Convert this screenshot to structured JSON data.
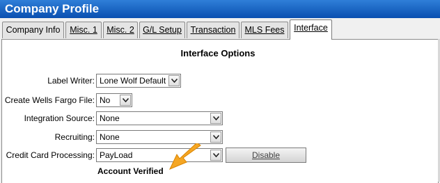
{
  "window": {
    "title": "Company Profile"
  },
  "tabs": [
    {
      "label": "Company Info",
      "active": false
    },
    {
      "label": "Misc. 1",
      "active": false
    },
    {
      "label": "Misc. 2",
      "active": false
    },
    {
      "label": "G/L Setup",
      "active": false
    },
    {
      "label": "Transaction",
      "active": false
    },
    {
      "label": "MLS Fees",
      "active": false
    },
    {
      "label": "Interface",
      "active": true
    }
  ],
  "section": {
    "title": "Interface Options"
  },
  "fields": {
    "label_writer": {
      "label": "Label Writer:",
      "value": "Lone Wolf Default"
    },
    "wells_fargo": {
      "label": "Create Wells Fargo File:",
      "value": "No"
    },
    "integration_source": {
      "label": "Integration Source:",
      "value": "None"
    },
    "recruiting": {
      "label": "Recruiting:",
      "value": "None"
    },
    "credit_card": {
      "label": "Credit Card Processing:",
      "value": "PayLoad"
    }
  },
  "buttons": {
    "disable": "Disable"
  },
  "status": {
    "account": "Account Verified"
  },
  "icons": {
    "dropdown": "chevron-down-icon",
    "callout": "arrow-icon"
  },
  "colors": {
    "titlebar": "#0a4fb0",
    "arrow": "#f5a623"
  }
}
